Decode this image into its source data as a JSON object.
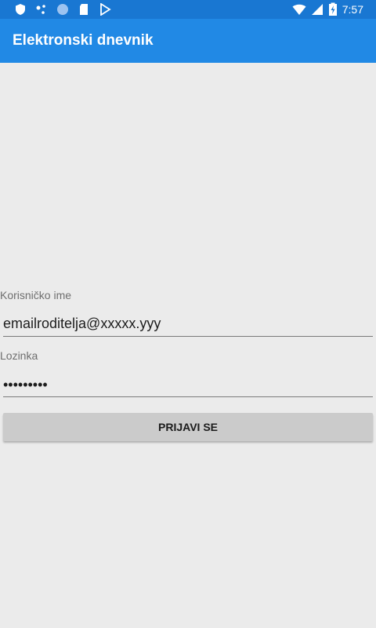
{
  "status_bar": {
    "time": "7:57",
    "left_icons": [
      "shield-icon",
      "share-nodes-icon",
      "circle-icon",
      "sd-card-icon",
      "play-store-icon"
    ],
    "right_icons": [
      "wifi-icon",
      "signal-icon",
      "battery-charging-icon"
    ]
  },
  "app_bar": {
    "title": "Elektronski dnevnik",
    "color": "#2189e5"
  },
  "login_form": {
    "username_label": "Korisničko ime",
    "username_value": "emailroditelja@xxxxx.yyy",
    "password_label": "Lozinka",
    "password_value": "•••••••••",
    "submit_label": "PRIJAVI SE"
  }
}
